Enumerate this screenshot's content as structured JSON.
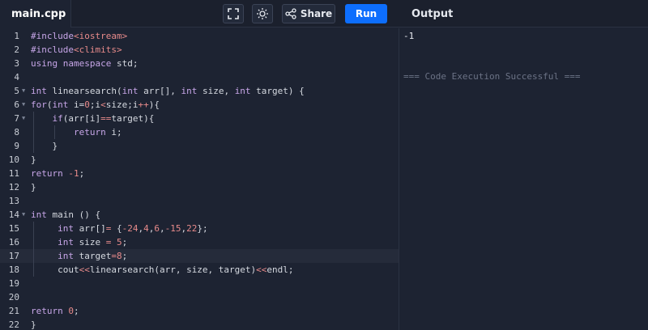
{
  "editor": {
    "tab_label": "main.cpp",
    "lines": [
      [
        [
          "#include",
          "k"
        ],
        [
          "<iostream>",
          "s"
        ]
      ],
      [
        [
          "#include",
          "k"
        ],
        [
          "<climits>",
          "s"
        ]
      ],
      [
        [
          "using namespace",
          "k"
        ],
        [
          " std;",
          ""
        ]
      ],
      [],
      [
        [
          "int",
          "k"
        ],
        [
          " linearsearch(",
          ""
        ],
        [
          "int",
          "k"
        ],
        [
          " arr[], ",
          ""
        ],
        [
          "int",
          "k"
        ],
        [
          " size, ",
          ""
        ],
        [
          "int",
          "k"
        ],
        [
          " target) {",
          ""
        ]
      ],
      [
        [
          "for",
          "k"
        ],
        [
          "(",
          ""
        ],
        [
          "int",
          "k"
        ],
        [
          " i=",
          ""
        ],
        [
          "0",
          "s"
        ],
        [
          ";i",
          ""
        ],
        [
          "<",
          "s"
        ],
        [
          "size;i",
          ""
        ],
        [
          "++",
          "s"
        ],
        [
          "){",
          ""
        ]
      ],
      [
        [
          "    ",
          ""
        ],
        [
          "if",
          "k"
        ],
        [
          "(arr[i]",
          ""
        ],
        [
          "==",
          "s"
        ],
        [
          "target){",
          ""
        ]
      ],
      [
        [
          "        ",
          ""
        ],
        [
          "return",
          "k"
        ],
        [
          " i;",
          ""
        ]
      ],
      [
        [
          "    }",
          ""
        ]
      ],
      [
        [
          "}",
          ""
        ]
      ],
      [
        [
          "return",
          "k"
        ],
        [
          " ",
          ""
        ],
        [
          "-1",
          "s"
        ],
        [
          ";",
          ""
        ]
      ],
      [
        [
          "}",
          ""
        ]
      ],
      [],
      [
        [
          "int",
          "k"
        ],
        [
          " main () {",
          ""
        ]
      ],
      [
        [
          "     ",
          ""
        ],
        [
          "int",
          "k"
        ],
        [
          " arr[]",
          ""
        ],
        [
          "=",
          "s"
        ],
        [
          " {",
          ""
        ],
        [
          "-24",
          "s"
        ],
        [
          ",",
          ""
        ],
        [
          "4",
          "s"
        ],
        [
          ",",
          ""
        ],
        [
          "6",
          "s"
        ],
        [
          ",",
          ""
        ],
        [
          "-15",
          "s"
        ],
        [
          ",",
          ""
        ],
        [
          "22",
          "s"
        ],
        [
          "};",
          ""
        ]
      ],
      [
        [
          "     ",
          ""
        ],
        [
          "int",
          "k"
        ],
        [
          " size ",
          ""
        ],
        [
          "=",
          "s"
        ],
        [
          " ",
          ""
        ],
        [
          "5",
          "s"
        ],
        [
          ";",
          ""
        ]
      ],
      [
        [
          "     ",
          ""
        ],
        [
          "int",
          "k"
        ],
        [
          " target",
          ""
        ],
        [
          "=",
          "s"
        ],
        [
          "8",
          "s"
        ],
        [
          ";",
          ""
        ]
      ],
      [
        [
          "     cout",
          ""
        ],
        [
          "<<",
          "s"
        ],
        [
          "linearsearch(arr, size, target)",
          ""
        ],
        [
          "<<",
          "s"
        ],
        [
          "endl;",
          ""
        ]
      ],
      [],
      [],
      [
        [
          "return",
          "k"
        ],
        [
          " ",
          ""
        ],
        [
          "0",
          "s"
        ],
        [
          ";",
          ""
        ]
      ],
      [
        [
          "}",
          ""
        ]
      ]
    ],
    "fold_lines": [
      5,
      6,
      7,
      14
    ],
    "active_line": 17
  },
  "toolbar": {
    "share_label": "Share",
    "run_label": "Run"
  },
  "output": {
    "title": "Output",
    "value": "-1",
    "status": "=== Code Execution Successful ==="
  },
  "colors": {
    "run_button": "#0d6efd",
    "keyword": "#c7a6e8",
    "literal": "#e88b8b"
  }
}
